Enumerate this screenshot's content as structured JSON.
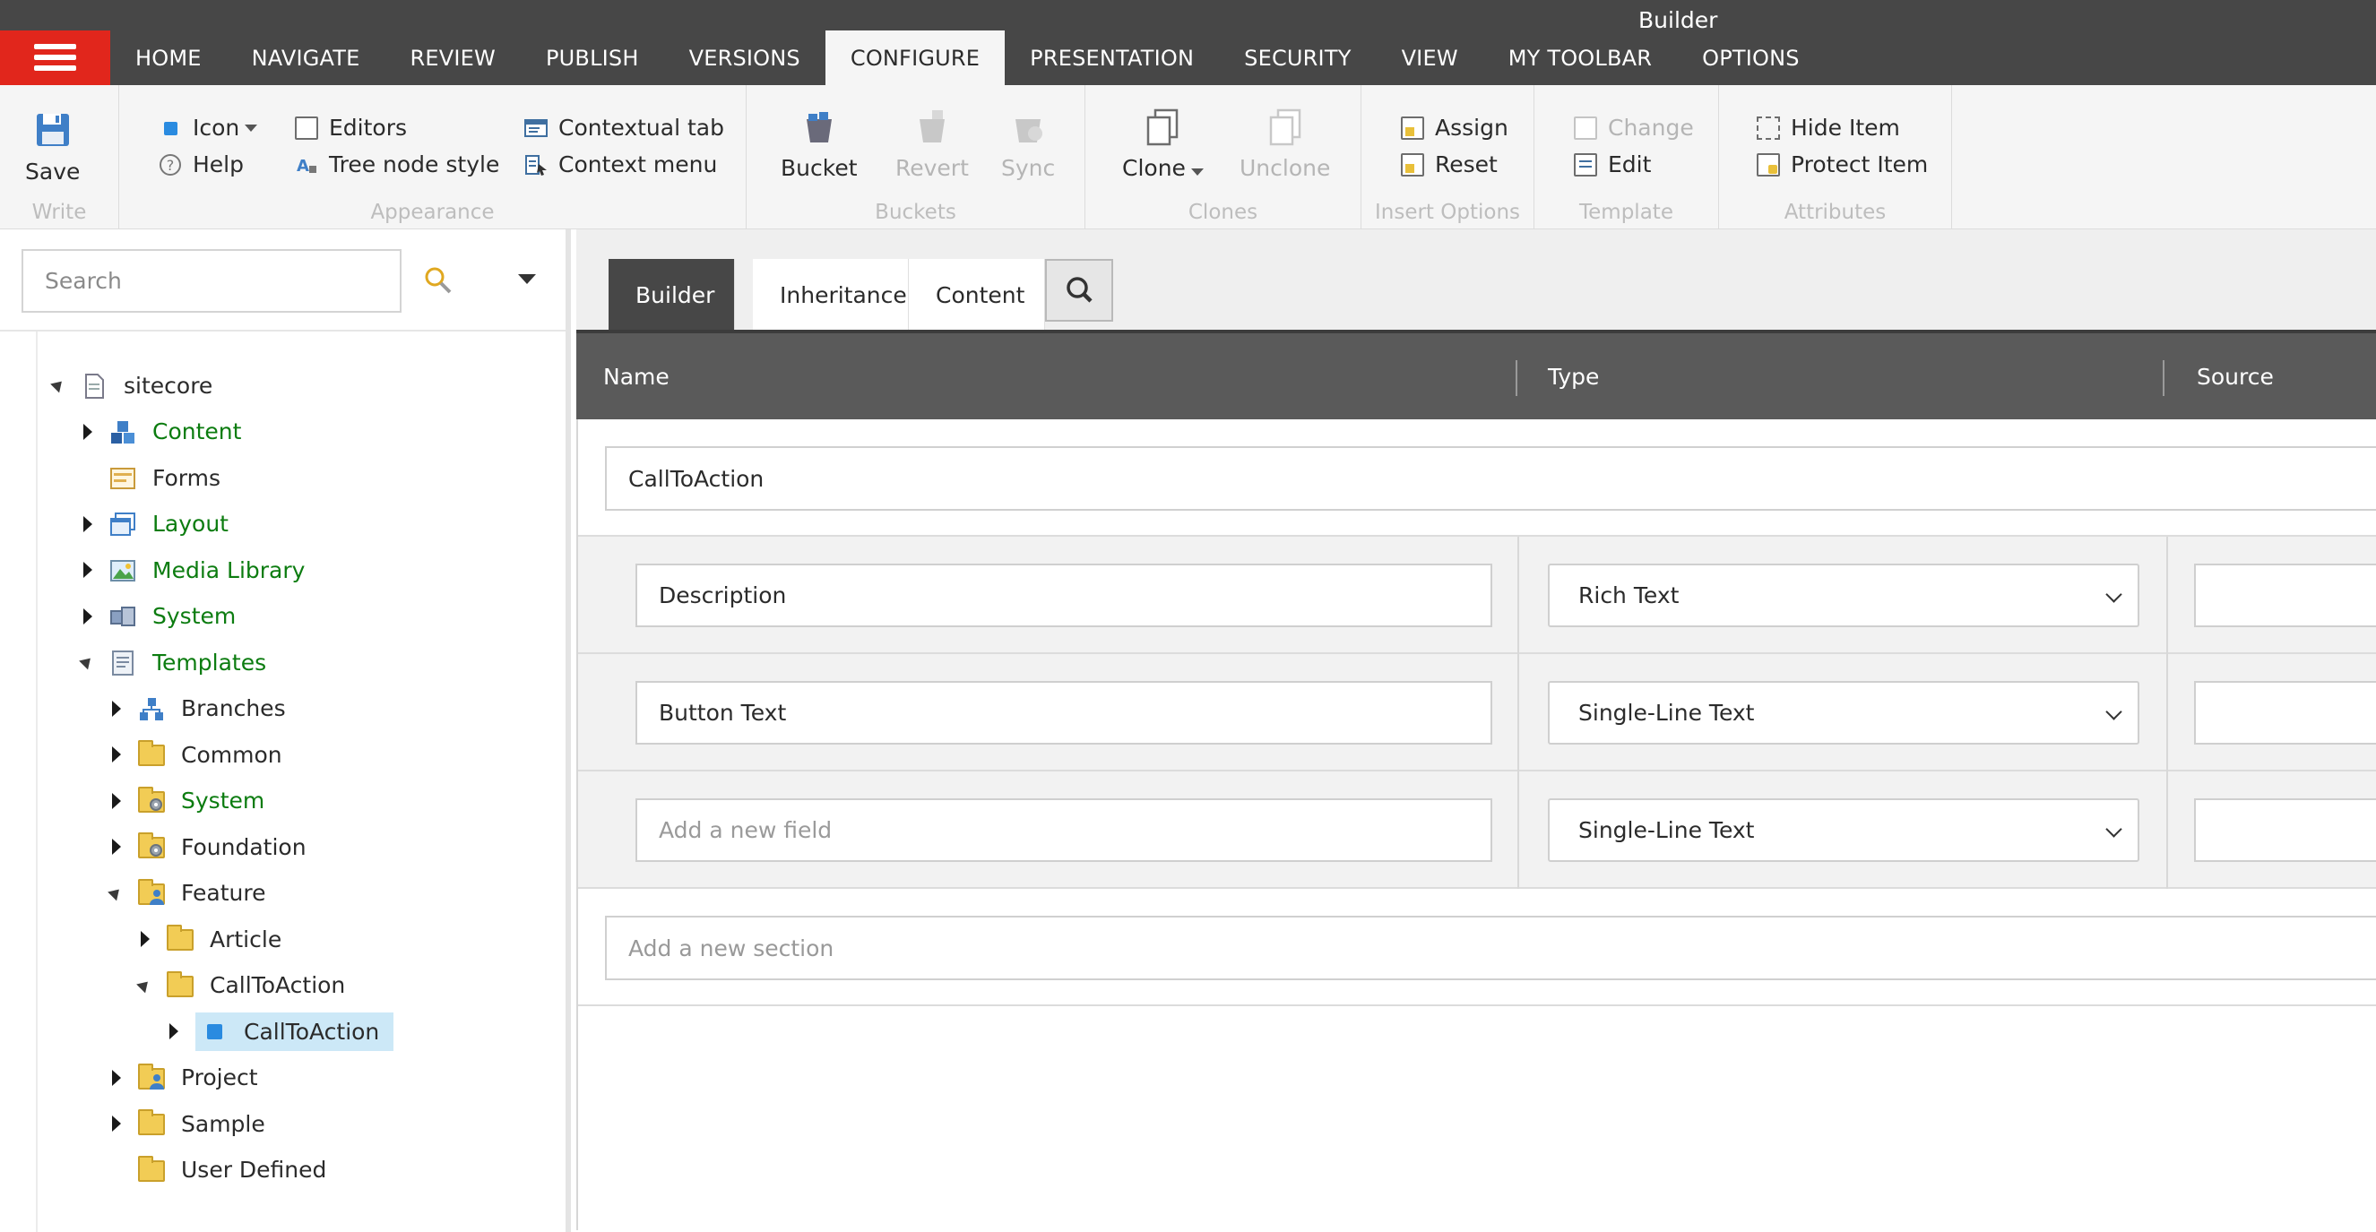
{
  "window": {
    "title": "Builder"
  },
  "menu_tabs": [
    "HOME",
    "NAVIGATE",
    "REVIEW",
    "PUBLISH",
    "VERSIONS",
    "CONFIGURE",
    "PRESENTATION",
    "SECURITY",
    "VIEW",
    "MY TOOLBAR",
    "OPTIONS"
  ],
  "active_menu_tab": "CONFIGURE",
  "ribbon": {
    "write": {
      "label": "Write",
      "save": "Save"
    },
    "appearance": {
      "label": "Appearance",
      "icon": "Icon",
      "help": "Help",
      "editors": "Editors",
      "tree_node_style": "Tree node style",
      "contextual_tab": "Contextual tab",
      "context_menu": "Context menu"
    },
    "buckets": {
      "label": "Buckets",
      "bucket": "Bucket",
      "revert": "Revert",
      "sync": "Sync"
    },
    "clones": {
      "label": "Clones",
      "clone": "Clone",
      "unclone": "Unclone"
    },
    "insert_options": {
      "label": "Insert Options",
      "assign": "Assign",
      "reset": "Reset"
    },
    "template": {
      "label": "Template",
      "change": "Change",
      "edit": "Edit"
    },
    "attributes": {
      "label": "Attributes",
      "hide_item": "Hide Item",
      "protect_item": "Protect Item"
    }
  },
  "search": {
    "placeholder": "Search"
  },
  "tree": [
    {
      "label": "sitecore",
      "depth": 0,
      "toggle": "down",
      "icon": "document-icon",
      "green": false
    },
    {
      "label": "Content",
      "depth": 1,
      "toggle": "right",
      "icon": "content-cubes-icon",
      "green": true
    },
    {
      "label": "Forms",
      "depth": 1,
      "toggle": "none",
      "icon": "forms-icon",
      "green": false
    },
    {
      "label": "Layout",
      "depth": 1,
      "toggle": "right",
      "icon": "layout-icon",
      "green": true
    },
    {
      "label": "Media Library",
      "depth": 1,
      "toggle": "right",
      "icon": "media-library-icon",
      "green": true
    },
    {
      "label": "System",
      "depth": 1,
      "toggle": "right",
      "icon": "system-icon",
      "green": true
    },
    {
      "label": "Templates",
      "depth": 1,
      "toggle": "down",
      "icon": "templates-icon",
      "green": true
    },
    {
      "label": "Branches",
      "depth": 2,
      "toggle": "right",
      "icon": "branches-icon",
      "green": false
    },
    {
      "label": "Common",
      "depth": 2,
      "toggle": "right",
      "icon": "folder-icon",
      "green": false
    },
    {
      "label": "System",
      "depth": 2,
      "toggle": "right",
      "icon": "system-folder-icon",
      "green": true
    },
    {
      "label": "Foundation",
      "depth": 2,
      "toggle": "right",
      "icon": "folder-gear-icon",
      "green": false
    },
    {
      "label": "Feature",
      "depth": 2,
      "toggle": "down",
      "icon": "folder-user-icon",
      "green": false
    },
    {
      "label": "Article",
      "depth": 3,
      "toggle": "right",
      "icon": "folder-icon",
      "green": false
    },
    {
      "label": "CallToAction",
      "depth": 3,
      "toggle": "down",
      "icon": "folder-icon",
      "green": false
    },
    {
      "label": "CallToAction",
      "depth": 4,
      "toggle": "right",
      "icon": "template-square-icon",
      "green": false,
      "selected": true
    },
    {
      "label": "Project",
      "depth": 2,
      "toggle": "right",
      "icon": "folder-user-icon",
      "green": false
    },
    {
      "label": "Sample",
      "depth": 2,
      "toggle": "right",
      "icon": "folder-icon",
      "green": false
    },
    {
      "label": "User Defined",
      "depth": 2,
      "toggle": "none",
      "icon": "folder-icon",
      "green": false
    }
  ],
  "editor_tabs": [
    "Builder",
    "Inheritance",
    "Content"
  ],
  "active_editor_tab": "Builder",
  "grid": {
    "headers": {
      "name": "Name",
      "type": "Type",
      "source": "Source"
    },
    "section_name": "CallToAction",
    "fields": [
      {
        "name": "Description",
        "type": "Rich Text",
        "placeholder": false
      },
      {
        "name": "Button Text",
        "type": "Single-Line Text",
        "placeholder": false
      },
      {
        "name": "Add a new field",
        "type": "Single-Line Text",
        "placeholder": true
      }
    ],
    "new_section_placeholder": "Add a new section"
  }
}
